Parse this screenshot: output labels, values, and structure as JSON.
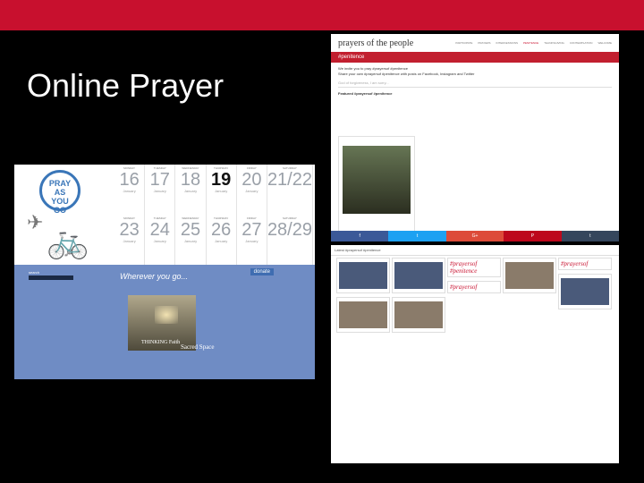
{
  "slide": {
    "title": "Online Prayer",
    "accent_color": "#c8102e"
  },
  "payg": {
    "logo": "PRAY AS YOU GO",
    "calendar": [
      {
        "dow": "MONDAY",
        "num": "16",
        "mon": "January",
        "active": false
      },
      {
        "dow": "TUESDAY",
        "num": "17",
        "mon": "January",
        "active": false
      },
      {
        "dow": "WEDNESDAY",
        "num": "18",
        "mon": "January",
        "active": false
      },
      {
        "dow": "THURSDAY",
        "num": "19",
        "mon": "January",
        "active": true
      },
      {
        "dow": "FRIDAY",
        "num": "20",
        "mon": "January",
        "active": false
      },
      {
        "dow": "SATURDAY",
        "num": "21/22",
        "mon": "",
        "active": false
      },
      {
        "dow": "MONDAY",
        "num": "23",
        "mon": "January",
        "active": false
      },
      {
        "dow": "TUESDAY",
        "num": "24",
        "mon": "January",
        "active": false
      },
      {
        "dow": "WEDNESDAY",
        "num": "25",
        "mon": "January",
        "active": false
      },
      {
        "dow": "THURSDAY",
        "num": "26",
        "mon": "January",
        "active": false
      },
      {
        "dow": "FRIDAY",
        "num": "27",
        "mon": "January",
        "active": false
      },
      {
        "dow": "SATURDAY",
        "num": "28/29",
        "mon": "",
        "active": false
      }
    ],
    "donate": "donate",
    "tagline": "Wherever you go...",
    "search_label": "search",
    "thinking_faith": "THINKING Faith",
    "sacred_space": "Sacred Space"
  },
  "potp": {
    "logo": "prayers of the people",
    "nav": [
      "PARTICIPATE",
      "PRAYERS",
      "INTERCESSIONS",
      "PENITENCE",
      "THANKSGIVING",
      "CONTEMPLATION",
      "WELCOME"
    ],
    "band": "#penitence",
    "line1": "We invite you to pray #prayersof #penitence",
    "line2": "Share your own #prayersof #penitence with posts on Facebook, Instagram and Twitter",
    "field_placeholder": "God of forgiveness, I am sorry...",
    "featured": "Featured #prayersof #penitence",
    "actions": [
      {
        "label": "f",
        "color": "#3b5998"
      },
      {
        "label": "t",
        "color": "#1da1f2"
      },
      {
        "label": "G+",
        "color": "#dd4b39"
      },
      {
        "label": "P",
        "color": "#bd081c"
      },
      {
        "label": "t",
        "color": "#35465c"
      }
    ]
  },
  "tumblr": {
    "header": "Latest #prayersof #penitence",
    "hash1": "#prayersof #penitence",
    "hash2": "#prayersof",
    "hash3": "#prayersof"
  }
}
